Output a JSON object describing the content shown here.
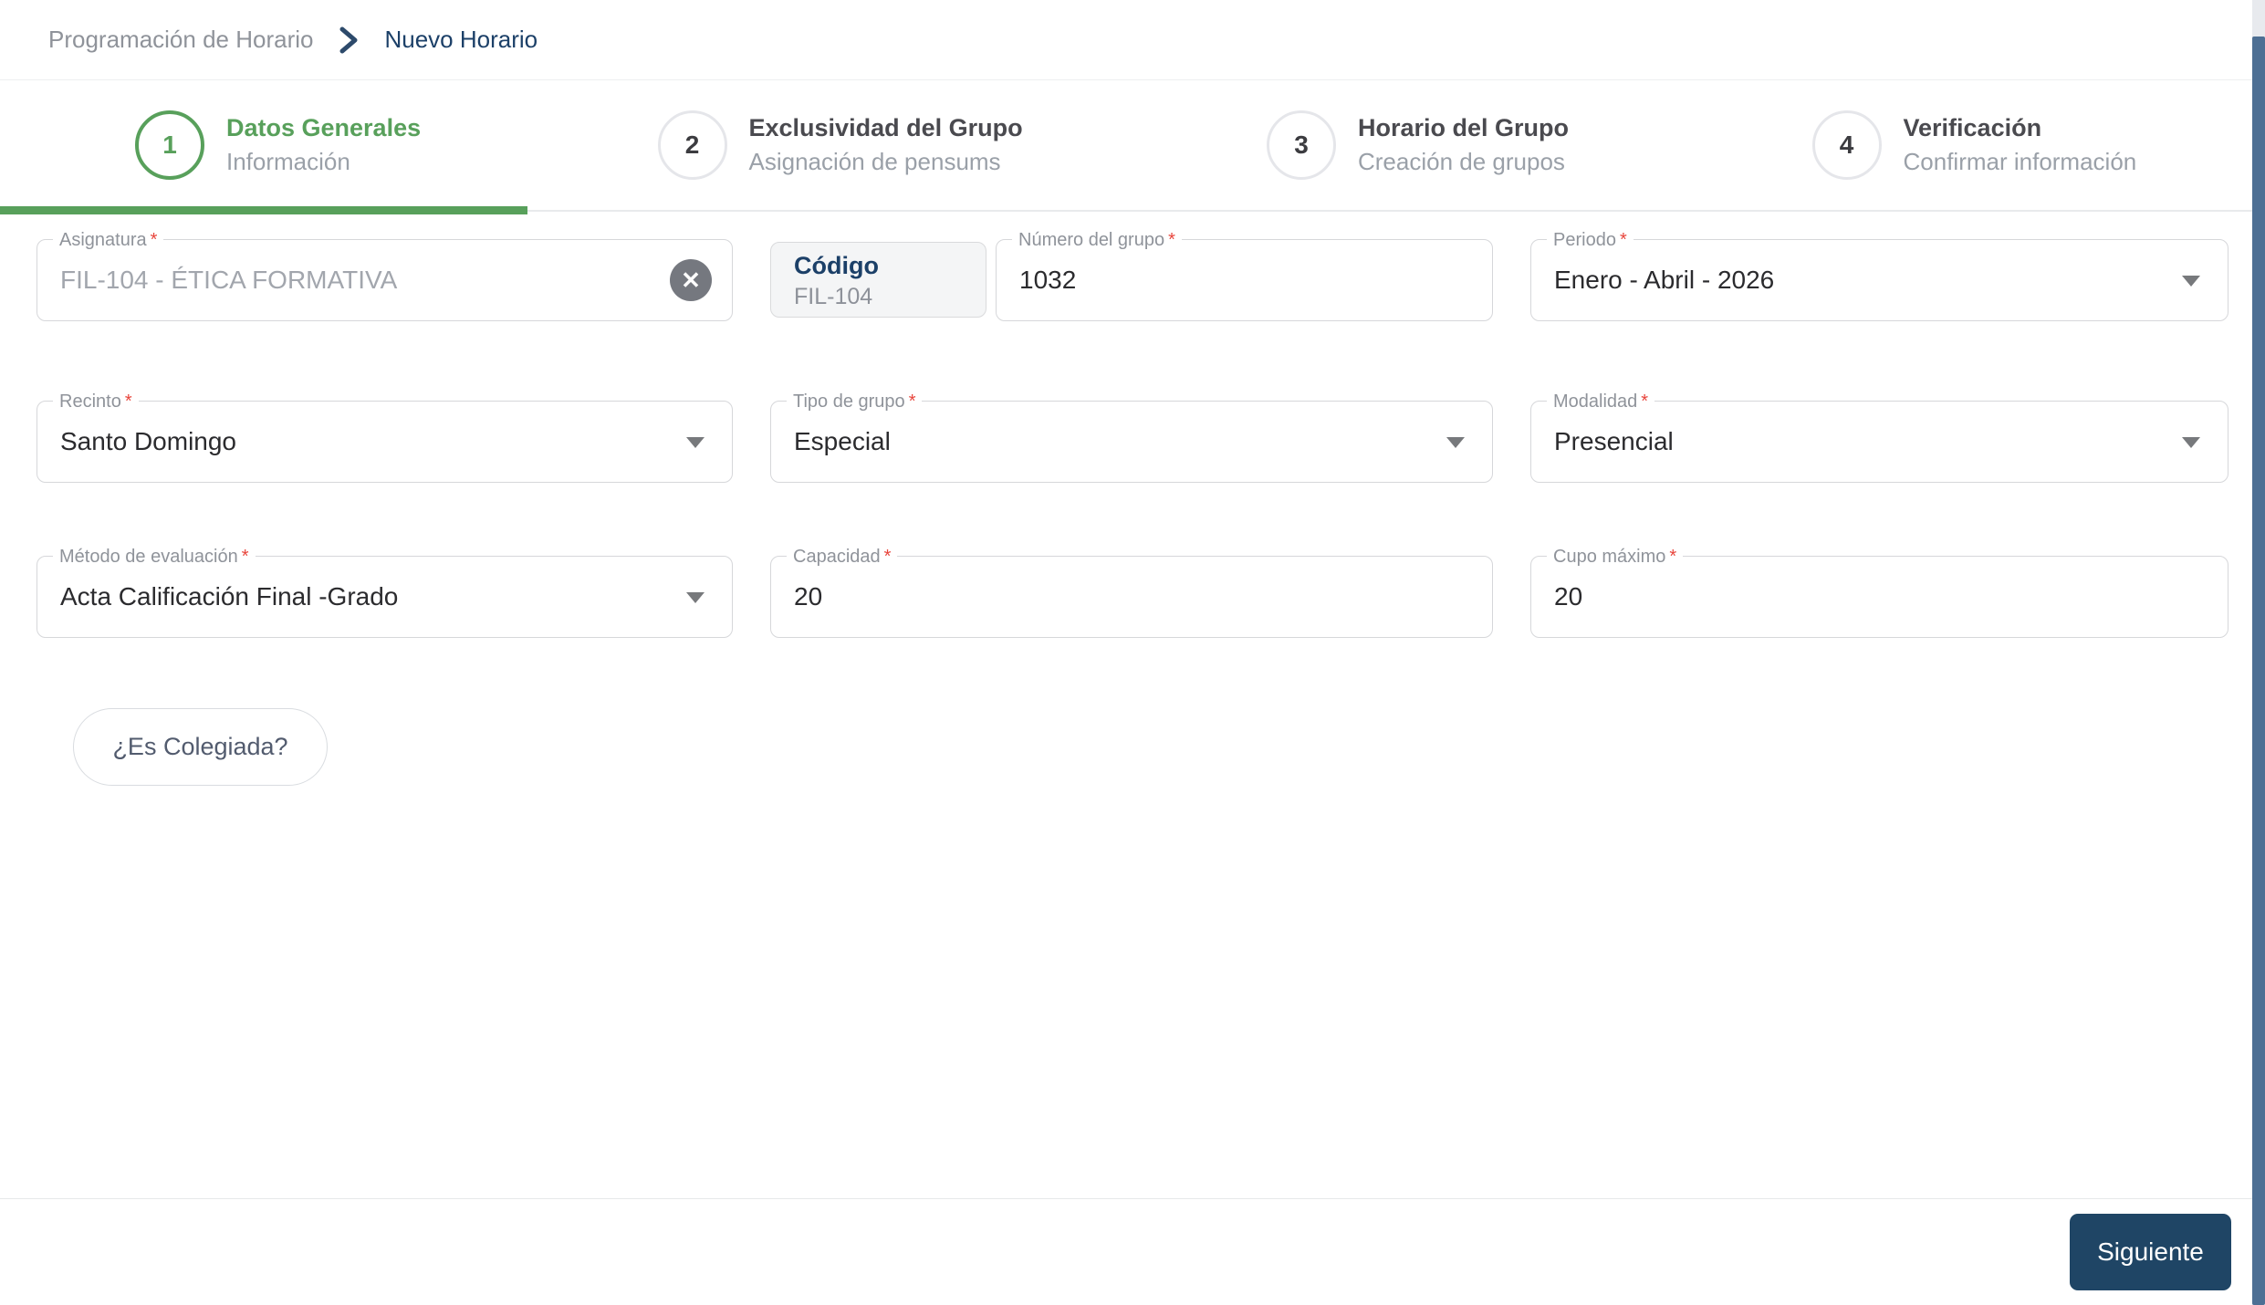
{
  "ui": {
    "required_marker": "*"
  },
  "colors": {
    "accent_green": "#58a05b",
    "navy": "#1c4068",
    "button_navy": "#1f4565",
    "required_red": "#e8453c",
    "scrollbar_thumb": "#4d6f94"
  },
  "breadcrumb": {
    "parent": "Programación de Horario",
    "current": "Nuevo Horario"
  },
  "stepper": {
    "steps": [
      {
        "number": "1",
        "title": "Datos Generales",
        "subtitle": "Información",
        "state": "active"
      },
      {
        "number": "2",
        "title": "Exclusividad del Grupo",
        "subtitle": "Asignación de pensums",
        "state": "inactive"
      },
      {
        "number": "3",
        "title": "Horario del Grupo",
        "subtitle": "Creación de grupos",
        "state": "inactive"
      },
      {
        "number": "4",
        "title": "Verificación",
        "subtitle": "Confirmar información",
        "state": "inactive"
      }
    ]
  },
  "form": {
    "asignatura": {
      "label": "Asignatura",
      "value": "FIL-104 - ÉTICA FORMATIVA",
      "required": true
    },
    "codigo": {
      "label": "Código",
      "value": "FIL-104"
    },
    "numero_grupo": {
      "label": "Número del grupo",
      "value": "1032",
      "required": true
    },
    "periodo": {
      "label": "Periodo",
      "value": "Enero - Abril - 2026",
      "required": true
    },
    "recinto": {
      "label": "Recinto",
      "value": "Santo Domingo",
      "required": true
    },
    "tipo_grupo": {
      "label": "Tipo de grupo",
      "value": "Especial",
      "required": true
    },
    "modalidad": {
      "label": "Modalidad",
      "value": "Presencial",
      "required": true
    },
    "metodo_evaluacion": {
      "label": "Método de evaluación",
      "value": "Acta Calificación Final -Grado",
      "required": true
    },
    "capacidad": {
      "label": "Capacidad",
      "value": "20",
      "required": true
    },
    "cupo_maximo": {
      "label": "Cupo máximo",
      "value": "20",
      "required": true
    },
    "colegiada_button": "¿Es Colegiada?"
  },
  "footer": {
    "next_button": "Siguiente"
  }
}
